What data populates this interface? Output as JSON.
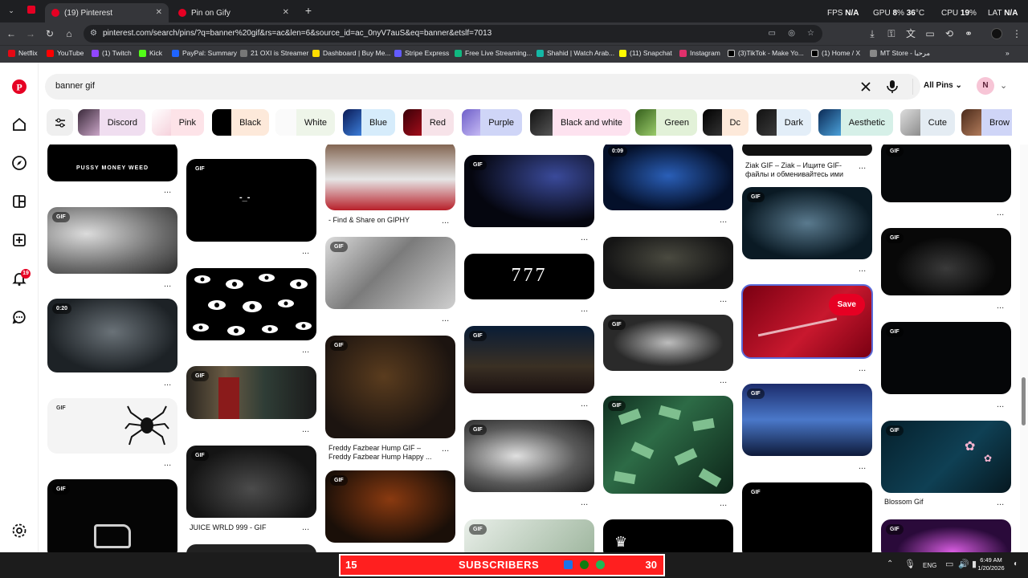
{
  "browser": {
    "tabs": [
      {
        "title": "(19) Pinterest",
        "active": true
      },
      {
        "title": "Pin on Gify",
        "active": false
      }
    ],
    "url": "pinterest.com/search/pins/?q=banner%20gif&rs=ac&len=6&source_id=ac_0nyV7auS&eq=banner&etslf=7013",
    "bookmarks": [
      "Netflix",
      "YouTube",
      "(1) Twitch",
      "Kick",
      "PayPal: Summary",
      "21 OXI is Streamer",
      "Dashboard | Buy Me...",
      "Stripe Express",
      "Free Live Streaming...",
      "Shahid | Watch Arab...",
      "(11) Snapchat",
      "Instagram",
      "(3)TikTok - Make Yo...",
      "(1) Home / X",
      "MT Store - مرحبا"
    ],
    "hud": {
      "fps_label": "FPS",
      "fps_value": "N/A",
      "gpu_label": "GPU",
      "gpu_value": "8",
      "gpu_unit": "%",
      "gpu_temp": "36",
      "gpu_temp_unit": "°C",
      "cpu_label": "CPU",
      "cpu_value": "19",
      "cpu_unit": "%",
      "lat_label": "LAT",
      "lat_value": "N/A"
    }
  },
  "search": {
    "query": "banner gif",
    "filter": "All Pins",
    "avatar_letter": "N"
  },
  "chips": [
    "Discord",
    "Pink",
    "Black",
    "White",
    "Blue",
    "Red",
    "Purple",
    "Black and white",
    "Green",
    "Dc",
    "Dark",
    "Aesthetic",
    "Cute",
    "Brow"
  ],
  "colors": {
    "brand": "#e60023",
    "notif": "#e60023"
  },
  "notifications": {
    "count": "19"
  },
  "pins": {
    "badge_gif": "GIF",
    "c1p1_text": "PUSSY  MONEY  WEED",
    "c1p3_badge": "0:20",
    "c2p5_caption": "JUICE WRLD 999 - GIF",
    "c3p1_caption": "- Find & Share on GIPHY",
    "c3p3_caption": "Freddy Fazbear Hump GIF – Freddy Fazbear Hump Happy ...",
    "c4p2_text": "777",
    "c5p1_badge": "0:09",
    "c6p1_caption": "Ziak GIF – Ziak – Ищите GIF-файлы и обменивайтесь ими",
    "c6p3_save": "Save",
    "c7p5_caption": "Blossom Gif",
    "dots": "..."
  },
  "taskbar": {
    "sub_left": "15",
    "sub_text": "SUBSCRIBERS",
    "sub_right": "30",
    "lang": "ENG",
    "time": "6:49 AM",
    "date": "1/20/2026"
  }
}
